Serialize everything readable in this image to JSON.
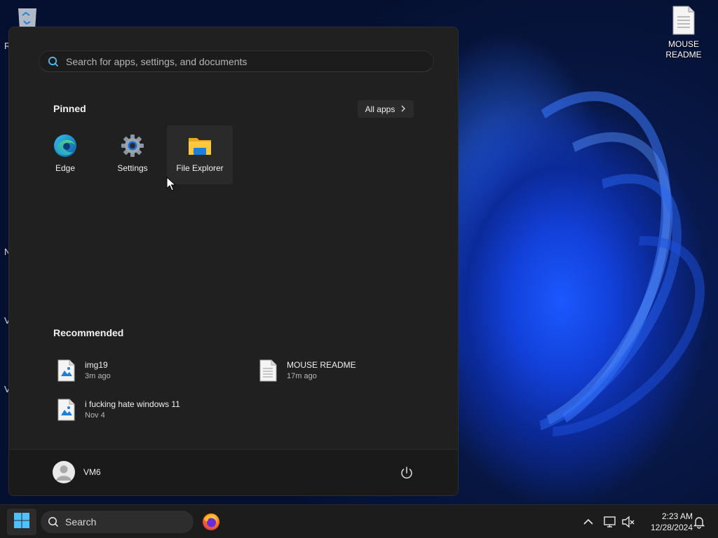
{
  "desktop": {
    "icons": [
      {
        "label": "MOUSE README",
        "icon": "text-file-icon"
      }
    ],
    "left_edge_letters": [
      "R",
      "N",
      "V",
      "V"
    ]
  },
  "start_menu": {
    "search": {
      "placeholder": "Search for apps, settings, and documents",
      "icon": "search-icon"
    },
    "pinned": {
      "title": "Pinned",
      "all_apps_label": "All apps",
      "items": [
        {
          "label": "Edge",
          "icon": "edge-icon"
        },
        {
          "label": "Settings",
          "icon": "settings-gear-icon"
        },
        {
          "label": "File Explorer",
          "icon": "folder-icon"
        }
      ]
    },
    "recommended": {
      "title": "Recommended",
      "items": [
        {
          "name": "img19",
          "time": "3m ago",
          "icon": "image-file-icon"
        },
        {
          "name": "MOUSE README",
          "time": "17m ago",
          "icon": "text-file-icon"
        },
        {
          "name": "i fucking hate windows 11",
          "time": "Nov 4",
          "icon": "image-file-icon"
        }
      ]
    },
    "footer": {
      "user_name": "VM6",
      "power_icon": "power-icon"
    }
  },
  "taskbar": {
    "search_label": "Search",
    "clock": {
      "time": "2:23 AM",
      "date": "12/28/2024"
    }
  },
  "colors": {
    "menu_bg": "#202020",
    "taskbar_bg": "#1c1c1c",
    "wallpaper_accent": "#1b58ff",
    "windows_logo": "#4cc2ff"
  }
}
